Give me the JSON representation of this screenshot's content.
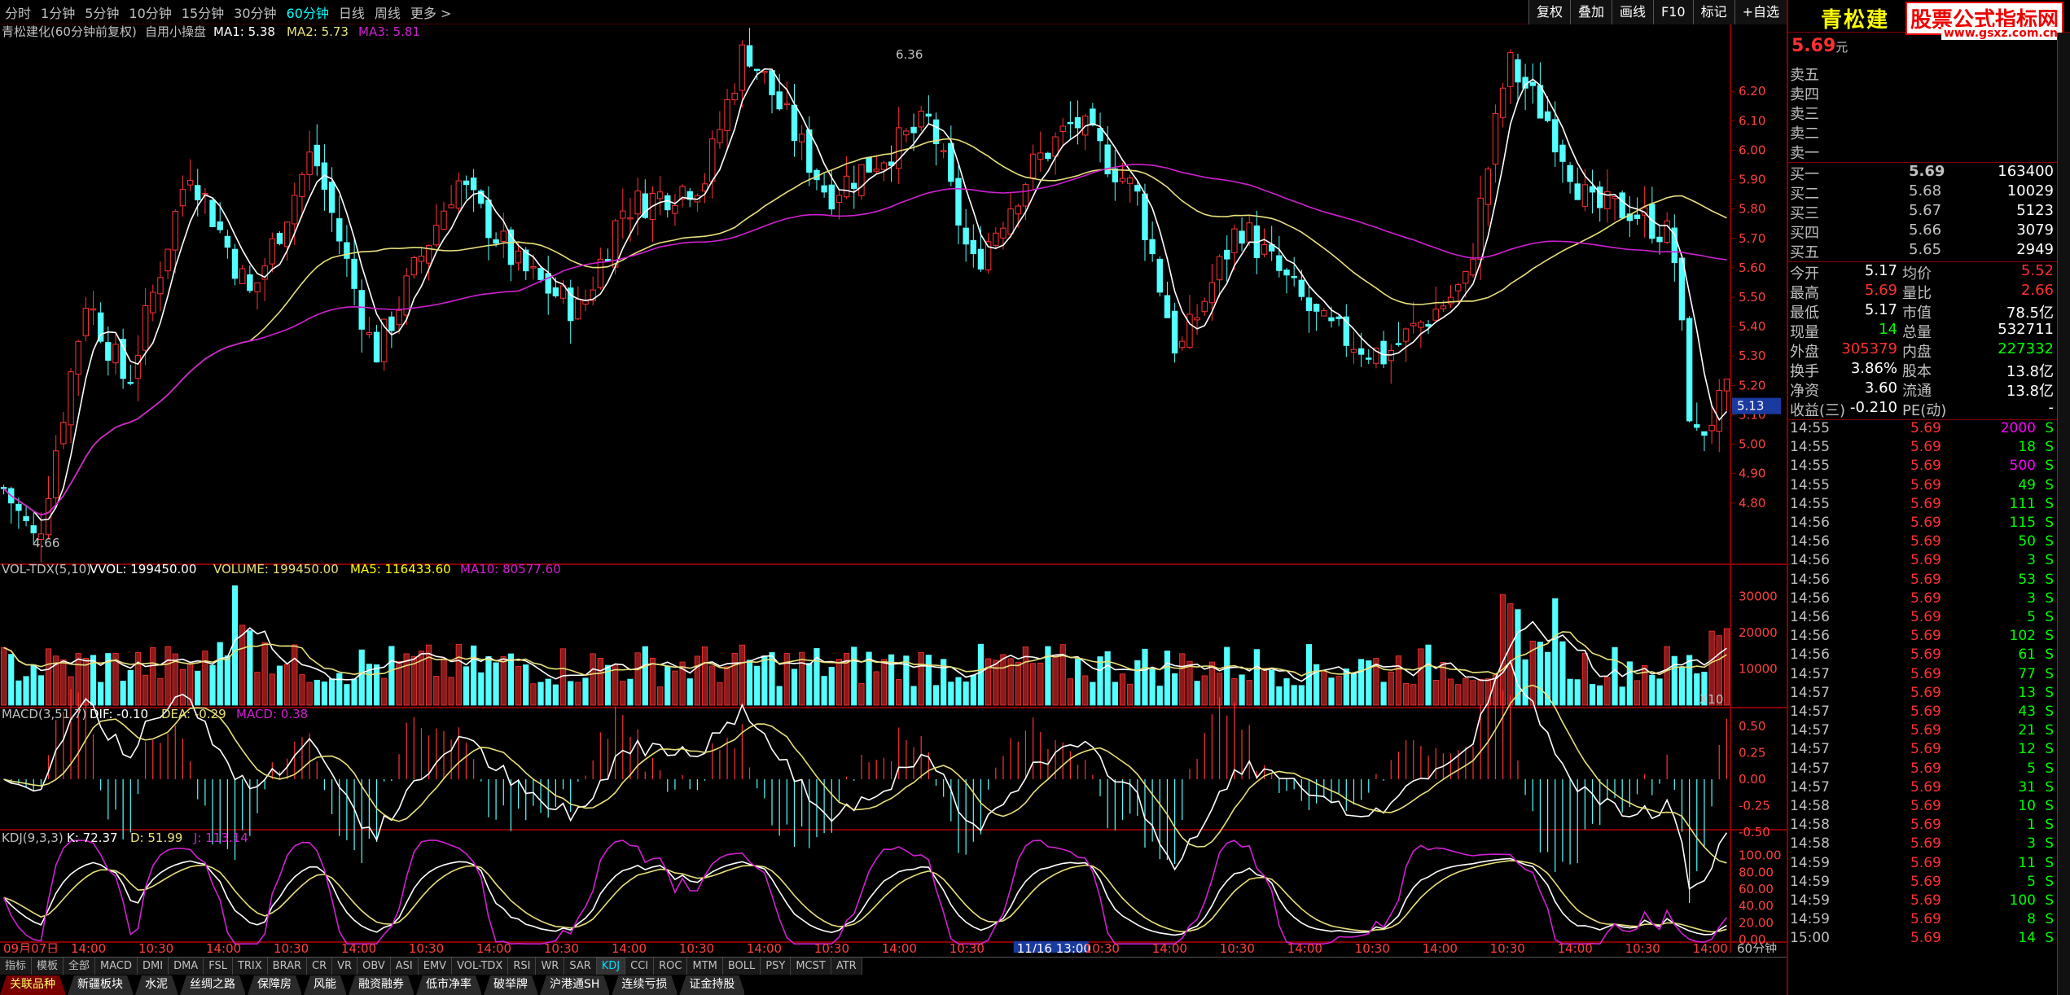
{
  "topbar": {
    "periods": [
      "分时",
      "1分钟",
      "5分钟",
      "10分钟",
      "15分钟",
      "30分钟",
      "60分钟",
      "日线",
      "周线",
      "更多 >"
    ],
    "active_index": 6,
    "tools": [
      "复权",
      "叠加",
      "画线",
      "F10",
      "标记",
      "+自选"
    ]
  },
  "main": {
    "title": "青松建化(60分钟前复权)",
    "formula": "自用小操盘",
    "ma1": "MA1: 5.38",
    "ma2": "MA2: 5.73",
    "ma3": "MA3: 5.81",
    "high_label": "6.36",
    "low_label": "4.66",
    "price_tag": "5.13",
    "yticks": [
      "6.20",
      "6.10",
      "6.00",
      "5.90",
      "5.80",
      "5.70",
      "5.60",
      "5.50",
      "5.40",
      "5.30",
      "5.20",
      "5.10",
      "5.00",
      "4.90",
      "4.80"
    ]
  },
  "vol": {
    "title": "VOL-TDX(5,10)",
    "vvol": "VVOL: 199450.00",
    "volume": "VOLUME: 199450.00",
    "ma5": "MA5: 116433.60",
    "ma10": "MA10: 80577.60",
    "yticks": [
      "30000",
      "20000",
      "10000"
    ],
    "unit": "X10"
  },
  "macd": {
    "title": "MACD(3,51,7)",
    "dif": "DIF: -0.10",
    "dea": "DEA: -0.29",
    "macd": "MACD: 0.38",
    "yticks": [
      "0.50",
      "0.25",
      "0.00",
      "-0.25",
      "-0.50"
    ]
  },
  "kdj": {
    "title": "KDJ(9,3,3)",
    "k": "K: 72.37",
    "d": "D: 51.99",
    "j": "J: 113.14",
    "yticks": [
      "100.00",
      "80.00",
      "60.00",
      "40.00",
      "20.00",
      "0.00"
    ]
  },
  "xaxis": {
    "labels": [
      "09月07日",
      "14:00",
      "10:30",
      "14:00",
      "10:30",
      "14:00",
      "10:30",
      "14:00",
      "10:30",
      "14:00",
      "10:30",
      "14:00",
      "10:30",
      "14:00",
      "10:30",
      "11/16 13:00",
      "10:30",
      "14:00",
      "10:30",
      "14:00",
      "10:30",
      "14:00",
      "10:30",
      "14:00",
      "10:30",
      "14:00"
    ],
    "period": "60分钟"
  },
  "indicator_tabs": [
    "指标",
    "模板",
    "全部",
    "MACD",
    "DMI",
    "DMA",
    "FSL",
    "TRIX",
    "BRAR",
    "CR",
    "VR",
    "OBV",
    "ASI",
    "EMV",
    "VOL-TDX",
    "RSI",
    "WR",
    "SAR",
    "KDJ",
    "CCI",
    "ROC",
    "MTM",
    "BOLL",
    "PSY",
    "MCST",
    "ATR"
  ],
  "sector_tabs": [
    "关联品种",
    "新疆板块",
    "水泥",
    "丝绸之路",
    "保障房",
    "风能",
    "融资融券",
    "低市净率",
    "破举牌",
    "沪港通SH",
    "连续亏损",
    "证金持股"
  ],
  "quote": {
    "name": "青松建",
    "watermark": "股票公式指标网",
    "watermark_url": "www.gsxz.com.cn",
    "price": "5.69",
    "price_unit": "元",
    "sells": [
      "卖五",
      "卖四",
      "卖三",
      "卖二",
      "卖一"
    ],
    "buys": [
      {
        "label": "买一",
        "price": "5.69",
        "vol": "163400"
      },
      {
        "label": "买二",
        "price": "5.68",
        "vol": "10029"
      },
      {
        "label": "买三",
        "price": "5.67",
        "vol": "5123"
      },
      {
        "label": "买四",
        "price": "5.66",
        "vol": "3079"
      },
      {
        "label": "买五",
        "price": "5.65",
        "vol": "2949"
      }
    ],
    "stats": [
      {
        "l": "今开",
        "v": "5.17",
        "vc": "white",
        "l2": "均价",
        "v2": "5.52",
        "v2c": "red"
      },
      {
        "l": "最高",
        "v": "5.69",
        "vc": "red",
        "l2": "量比",
        "v2": "2.66",
        "v2c": "red"
      },
      {
        "l": "最低",
        "v": "5.17",
        "vc": "white",
        "l2": "市值",
        "v2": "78.5亿",
        "v2c": "white"
      },
      {
        "l": "现量",
        "v": "14",
        "vc": "green",
        "l2": "总量",
        "v2": "532711",
        "v2c": "white"
      },
      {
        "l": "外盘",
        "v": "305379",
        "vc": "red",
        "l2": "内盘",
        "v2": "227332",
        "v2c": "green"
      },
      {
        "l": "换手",
        "v": "3.86%",
        "vc": "white",
        "l2": "股本",
        "v2": "13.8亿",
        "v2c": "white"
      },
      {
        "l": "净资",
        "v": "3.60",
        "vc": "white",
        "l2": "流通",
        "v2": "13.8亿",
        "v2c": "white"
      },
      {
        "l": "收益(三)",
        "v": "-0.210",
        "vc": "white",
        "l2": "PE(动)",
        "v2": "-",
        "v2c": "white"
      }
    ],
    "ticks": [
      {
        "t": "14:55",
        "p": "5.69",
        "v": "2000",
        "vc": "magenta"
      },
      {
        "t": "14:55",
        "p": "5.69",
        "v": "18",
        "vc": "green"
      },
      {
        "t": "14:55",
        "p": "5.69",
        "v": "500",
        "vc": "magenta"
      },
      {
        "t": "14:55",
        "p": "5.69",
        "v": "49",
        "vc": "green"
      },
      {
        "t": "14:55",
        "p": "5.69",
        "v": "111",
        "vc": "green"
      },
      {
        "t": "14:56",
        "p": "5.69",
        "v": "115",
        "vc": "green"
      },
      {
        "t": "14:56",
        "p": "5.69",
        "v": "50",
        "vc": "green"
      },
      {
        "t": "14:56",
        "p": "5.69",
        "v": "3",
        "vc": "green"
      },
      {
        "t": "14:56",
        "p": "5.69",
        "v": "53",
        "vc": "green"
      },
      {
        "t": "14:56",
        "p": "5.69",
        "v": "3",
        "vc": "green"
      },
      {
        "t": "14:56",
        "p": "5.69",
        "v": "5",
        "vc": "green"
      },
      {
        "t": "14:56",
        "p": "5.69",
        "v": "102",
        "vc": "green"
      },
      {
        "t": "14:56",
        "p": "5.69",
        "v": "61",
        "vc": "green"
      },
      {
        "t": "14:57",
        "p": "5.69",
        "v": "77",
        "vc": "green"
      },
      {
        "t": "14:57",
        "p": "5.69",
        "v": "13",
        "vc": "green"
      },
      {
        "t": "14:57",
        "p": "5.69",
        "v": "43",
        "vc": "green"
      },
      {
        "t": "14:57",
        "p": "5.69",
        "v": "21",
        "vc": "green"
      },
      {
        "t": "14:57",
        "p": "5.69",
        "v": "12",
        "vc": "green"
      },
      {
        "t": "14:57",
        "p": "5.69",
        "v": "5",
        "vc": "green"
      },
      {
        "t": "14:57",
        "p": "5.69",
        "v": "31",
        "vc": "green"
      },
      {
        "t": "14:58",
        "p": "5.69",
        "v": "10",
        "vc": "green"
      },
      {
        "t": "14:58",
        "p": "5.69",
        "v": "1",
        "vc": "green"
      },
      {
        "t": "14:58",
        "p": "5.69",
        "v": "3",
        "vc": "green"
      },
      {
        "t": "14:59",
        "p": "5.69",
        "v": "11",
        "vc": "green"
      },
      {
        "t": "14:59",
        "p": "5.69",
        "v": "5",
        "vc": "green"
      },
      {
        "t": "14:59",
        "p": "5.69",
        "v": "100",
        "vc": "green"
      },
      {
        "t": "14:59",
        "p": "5.69",
        "v": "8",
        "vc": "green"
      },
      {
        "t": "15:00",
        "p": "5.69",
        "v": "14",
        "vc": "green"
      }
    ],
    "tick_side": "S"
  }
}
